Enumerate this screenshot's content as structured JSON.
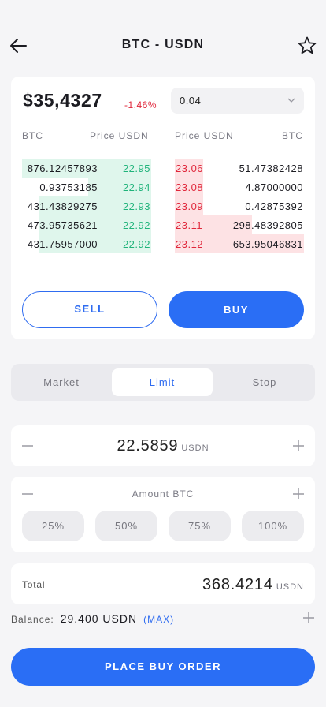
{
  "header": {
    "title": "BTC - USDN"
  },
  "ticker": {
    "price": "$35,4327",
    "change": "-1.46%",
    "change_color": "#e0263a"
  },
  "quantity_select": {
    "value": "0.04"
  },
  "orderbook": {
    "bid_headers": {
      "left": "BTC",
      "right": "Price USDN"
    },
    "ask_headers": {
      "left": "Price USDN",
      "right": "BTC"
    },
    "bids": [
      {
        "qty": "876.12457893",
        "price": "22.95",
        "depth": 1.0
      },
      {
        "qty": "0.93753185",
        "price": "22.94",
        "depth": 0.49
      },
      {
        "qty": "431.43829275",
        "price": "22.93",
        "depth": 0.87
      },
      {
        "qty": "473.95735621",
        "price": "22.92",
        "depth": 0.87
      },
      {
        "qty": "431.75957000",
        "price": "22.92",
        "depth": 0.87
      }
    ],
    "asks": [
      {
        "price": "23.06",
        "qty": "51.47382428",
        "depth": 0.22
      },
      {
        "price": "23.08",
        "qty": "4.87000000",
        "depth": 0.22
      },
      {
        "price": "23.09",
        "qty": "0.42875392",
        "depth": 0.22
      },
      {
        "price": "23.11",
        "qty": "298.48392805",
        "depth": 0.6
      },
      {
        "price": "23.12",
        "qty": "653.95046831",
        "depth": 1.0
      }
    ],
    "bid_color": "#1fb37a",
    "ask_color": "#e0263a"
  },
  "actions": {
    "sell_label": "SELL",
    "buy_label": "BUY"
  },
  "tabs": [
    {
      "label": "Market",
      "active": false
    },
    {
      "label": "Limit",
      "active": true
    },
    {
      "label": "Stop",
      "active": false
    }
  ],
  "price_input": {
    "value": "22.5859",
    "unit": "USDN"
  },
  "amount": {
    "label": "Amount BTC",
    "presets": [
      "25%",
      "50%",
      "75%",
      "100%"
    ]
  },
  "total": {
    "label": "Total",
    "value": "368.4214",
    "unit": "USDN"
  },
  "balance": {
    "label": "Balance:",
    "value": "29.400 USDN",
    "max_label": "(MAX)"
  },
  "place_order": {
    "label": "PLACE BUY ORDER"
  },
  "colors": {
    "accent": "#2a6ef5"
  }
}
